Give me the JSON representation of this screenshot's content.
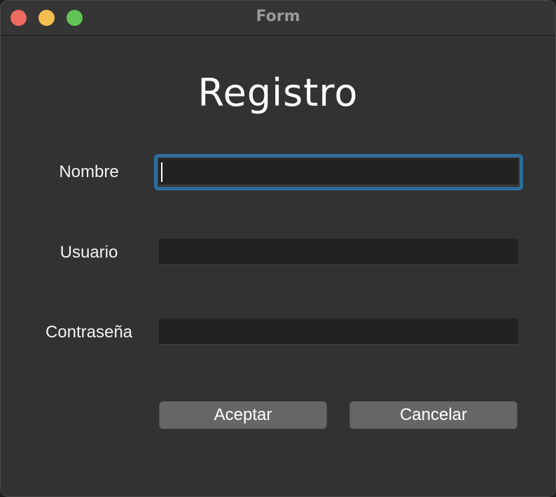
{
  "window": {
    "title": "Form",
    "controls": {
      "close_color": "#ed6a5e",
      "minimize_color": "#f5bf4f",
      "zoom_color": "#61c454"
    }
  },
  "form": {
    "heading": "Registro",
    "fields": [
      {
        "label": "Nombre",
        "value": "",
        "focused": true
      },
      {
        "label": "Usuario",
        "value": ""
      },
      {
        "label": "Contraseña",
        "value": ""
      }
    ],
    "buttons": {
      "accept_label": "Aceptar",
      "cancel_label": "Cancelar"
    }
  },
  "colors": {
    "background": "#323232",
    "input_background": "#222222",
    "focus_ring": "#2c6e9b",
    "button": "#666666"
  }
}
